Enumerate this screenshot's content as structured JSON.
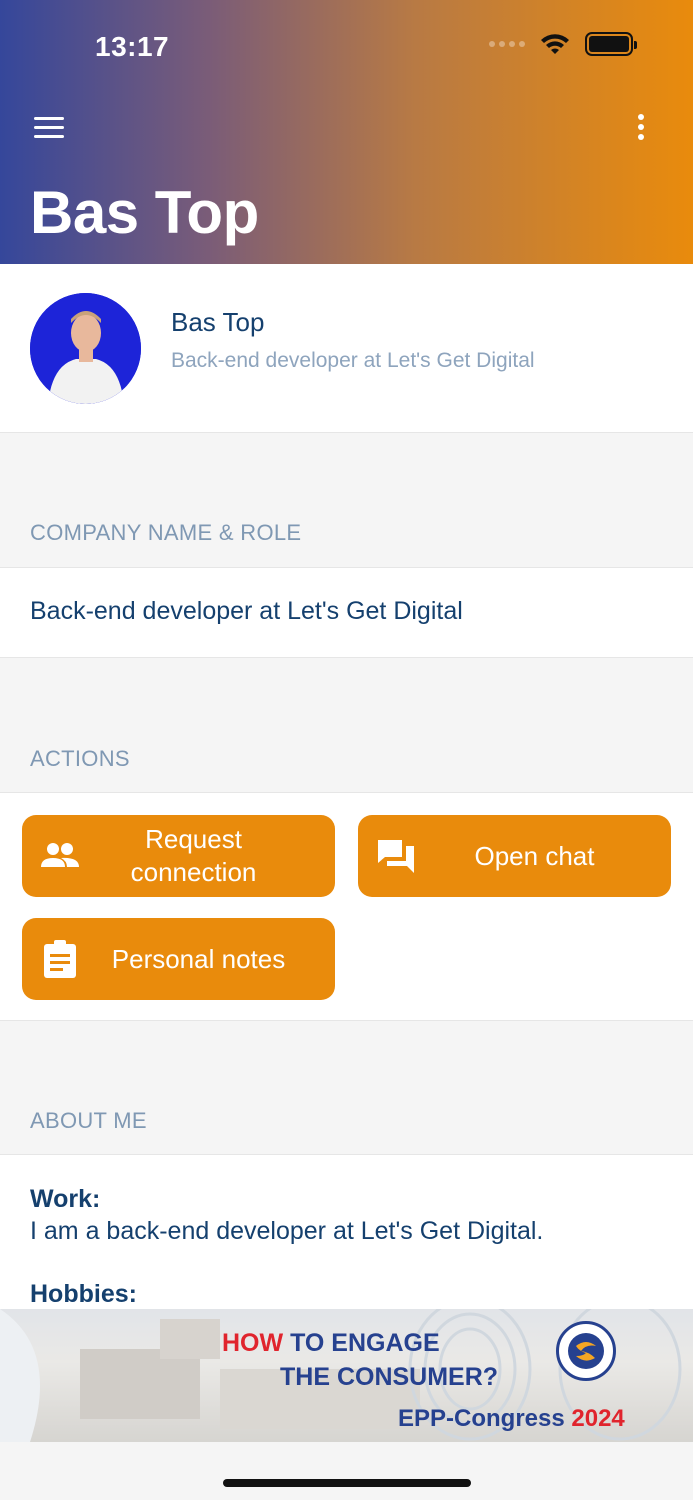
{
  "status_bar": {
    "time": "13:17"
  },
  "header": {
    "title": "Bas Top"
  },
  "profile": {
    "name": "Bas Top",
    "subtitle": "Back-end developer at Let's Get Digital"
  },
  "sections": {
    "company": {
      "label": "COMPANY NAME & ROLE",
      "value": "Back-end developer at Let's Get Digital"
    },
    "actions": {
      "label": "ACTIONS",
      "buttons": [
        {
          "label": "Request connection",
          "icon": "people-icon"
        },
        {
          "label": "Open chat",
          "icon": "chat-icon"
        },
        {
          "label": "Personal notes",
          "icon": "clipboard-icon"
        }
      ]
    },
    "about": {
      "label": "ABOUT ME",
      "work_title": "Work:",
      "work_text": "I am a back-end developer at Let's Get Digital.",
      "hobbies_title": "Hobbies:"
    }
  },
  "banner": {
    "line1_red": "HOW",
    "line1_blue": "TO ENGAGE",
    "line2": "THE CONSUMER?",
    "line3_blue": "EPP-Congress",
    "line3_red": "2024"
  },
  "colors": {
    "accent": "#e98b0c",
    "text_primary": "#15406e",
    "text_muted": "#7f98b3"
  }
}
